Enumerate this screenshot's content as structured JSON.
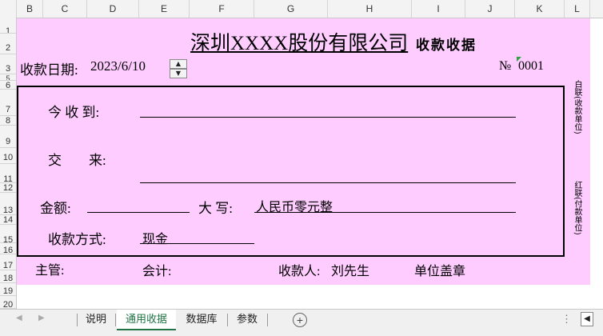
{
  "columns": [
    "B",
    "C",
    "D",
    "E",
    "F",
    "G",
    "H",
    "I",
    "J",
    "K",
    "L"
  ],
  "rows": [
    "1",
    "2",
    "3",
    "5",
    "6",
    "7",
    "8",
    "9",
    "10",
    "11",
    "12",
    "13",
    "14",
    "15",
    "16",
    "17",
    "18",
    "19",
    "20"
  ],
  "receipt": {
    "company": "深圳XXXX股份有限公司",
    "title": "收款收据",
    "date_label": "收款日期:",
    "date_value": "2023/6/10",
    "number_label": "№",
    "number_value": "0001",
    "receive_from_label": "今 收 到:",
    "pay_for_label": "交　　来:",
    "amount_label": "金额:",
    "amount_value": "",
    "capital_label": "大 写:",
    "capital_value": "人民币零元整",
    "method_label": "收款方式:",
    "method_value": "现金",
    "supervisor_label": "主管:",
    "accountant_label": "会计:",
    "payee_label": "收款人:",
    "payee_value": "刘先生",
    "stamp_label": "单位盖章",
    "side_note_white": "白联(收款单位)",
    "side_note_red": "红联(付款单位)"
  },
  "sheet_tabs": [
    "说明",
    "通用收据",
    "数据库",
    "参数"
  ],
  "active_tab": "通用收据",
  "colors": {
    "sheet_bg": "#ffccff",
    "active_tab": "#217346"
  }
}
